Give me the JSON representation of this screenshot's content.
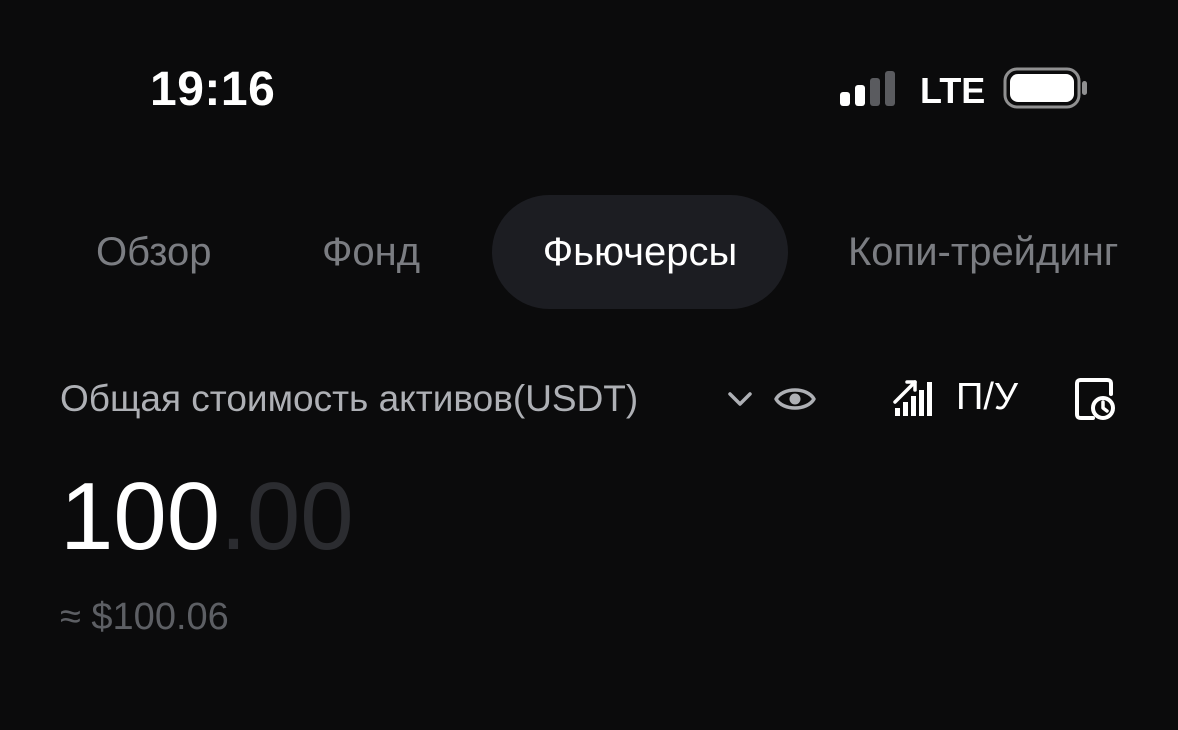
{
  "status_bar": {
    "time": "19:16",
    "network": "LTE",
    "signal_bars_active": 2,
    "signal_bars_total": 4
  },
  "tabs": [
    {
      "label": "Обзор",
      "active": false
    },
    {
      "label": "Фонд",
      "active": false
    },
    {
      "label": "Фьючерсы",
      "active": true
    },
    {
      "label": "Копи-трейдинг",
      "active": false
    }
  ],
  "assets": {
    "label": "Общая стоимость активов(USDT)",
    "pnl_label": "П/У",
    "balance_integer": "100",
    "balance_decimal": ".00",
    "usd_equivalent": "≈ $100.06"
  },
  "icons": {
    "chevron": "chevron-down-icon",
    "eye": "eye-icon",
    "pnl": "signal-chart-icon",
    "history": "document-clock-icon"
  },
  "colors": {
    "background": "#0b0b0c",
    "active_tab_bg": "#1c1d22",
    "inactive_tab_text": "#7b7d82",
    "label_text": "#aeb0b5",
    "muted_text": "#5d5f64",
    "balance_decimal": "#2b2c30"
  }
}
